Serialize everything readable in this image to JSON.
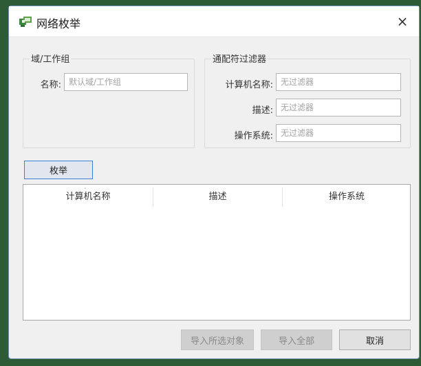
{
  "window": {
    "title": "网络枚举",
    "close_glyph": "×"
  },
  "domain_group": {
    "label": "域/工作组",
    "name_label": "名称:",
    "name_placeholder": "默认域/工作组",
    "name_value": ""
  },
  "filter_group": {
    "label": "通配符过滤器",
    "computer_name_label": "计算机名称:",
    "computer_name_placeholder": "无过滤器",
    "description_label": "描述:",
    "description_placeholder": "无过滤器",
    "os_label": "操作系统:",
    "os_placeholder": "无过滤器"
  },
  "enum_button": {
    "label": "枚举"
  },
  "table": {
    "columns": [
      "计算机名称",
      "描述",
      "操作系统"
    ],
    "sort_glyph": "ˇ",
    "rows": []
  },
  "footer": {
    "import_selected_label": "导入所选对象",
    "import_all_label": "导入全部",
    "cancel_label": "取消"
  },
  "colors": {
    "accent_border": "#3c7fd2",
    "background": "#f0f0f0"
  },
  "icons": {
    "app": "network-computer-icon",
    "close": "close-icon"
  }
}
